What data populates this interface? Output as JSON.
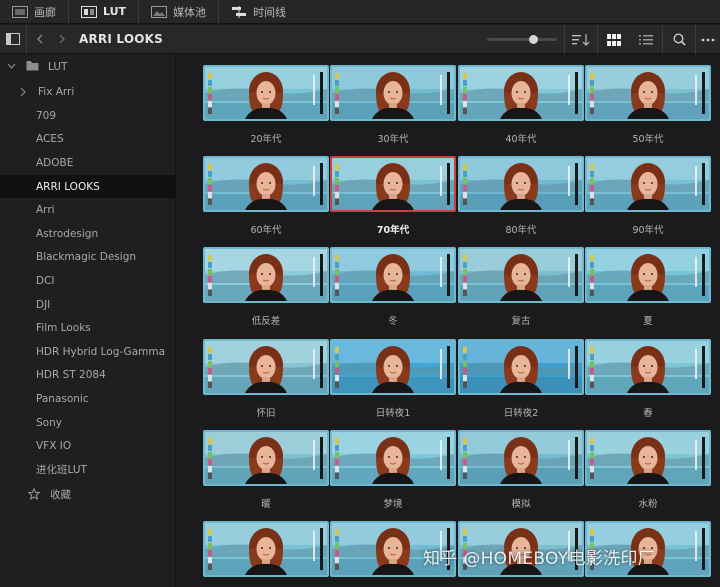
{
  "top_tabs": [
    {
      "label": "画廊",
      "icon": "gallery-icon"
    },
    {
      "label": "LUT",
      "icon": "lut-icon",
      "active": true
    },
    {
      "label": "媒体池",
      "icon": "media-pool-icon"
    },
    {
      "label": "时间线",
      "icon": "timeline-icon"
    }
  ],
  "toolbar": {
    "title": "ARRI LOOKS",
    "zoom_level": 0.45
  },
  "sidebar": {
    "root": "LUT",
    "items": [
      {
        "label": "Fix Arri",
        "expandable": true
      },
      {
        "label": "709"
      },
      {
        "label": "ACES"
      },
      {
        "label": "ADOBE"
      },
      {
        "label": "ARRI LOOKS",
        "selected": true
      },
      {
        "label": "Arri"
      },
      {
        "label": "Astrodesign"
      },
      {
        "label": "Blackmagic Design"
      },
      {
        "label": "DCI"
      },
      {
        "label": "DJI"
      },
      {
        "label": "Film Looks"
      },
      {
        "label": "HDR Hybrid Log-Gamma"
      },
      {
        "label": "HDR ST 2084"
      },
      {
        "label": "Panasonic"
      },
      {
        "label": "Sony"
      },
      {
        "label": "VFX IO"
      },
      {
        "label": "进化班LUT"
      }
    ],
    "favorites": "收藏"
  },
  "thumbnails": [
    {
      "label": "20年代",
      "tint": "#79c3d6"
    },
    {
      "label": "30年代",
      "tint": "#6fbcd2"
    },
    {
      "label": "40年代",
      "tint": "#82c7d8"
    },
    {
      "label": "50年代",
      "tint": "#7cc0d3"
    },
    {
      "label": "60年代",
      "tint": "#74bdd4"
    },
    {
      "label": "70年代",
      "tint": "#7ac2d5",
      "selected": true
    },
    {
      "label": "80年代",
      "tint": "#6eb9d1"
    },
    {
      "label": "90年代",
      "tint": "#77c0d5"
    },
    {
      "label": "低反差",
      "tint": "#8ccbd9"
    },
    {
      "label": "冬",
      "tint": "#70bcd6"
    },
    {
      "label": "复古",
      "tint": "#7cbfcf"
    },
    {
      "label": "夏",
      "tint": "#76c4d8"
    },
    {
      "label": "怀旧",
      "tint": "#86c5d3"
    },
    {
      "label": "日转夜1",
      "tint": "#3fa6d6"
    },
    {
      "label": "日转夜2",
      "tint": "#3b9fd0"
    },
    {
      "label": "春",
      "tint": "#7cc6d6"
    },
    {
      "label": "暖",
      "tint": "#7fc1cf"
    },
    {
      "label": "梦境",
      "tint": "#7ec8db"
    },
    {
      "label": "模拟",
      "tint": "#74bbd0"
    },
    {
      "label": "水粉",
      "tint": "#7ec5d6"
    },
    {
      "label": "",
      "tint": "#79c1d4"
    },
    {
      "label": "",
      "tint": "#72bdd3"
    },
    {
      "label": "",
      "tint": "#7bc0d2"
    },
    {
      "label": "",
      "tint": "#78c2d6"
    }
  ],
  "colors": {
    "selection_border": "#c9433b",
    "background": "#1b1b1d",
    "sidebar_bg": "#1f1f22"
  },
  "watermark": "知乎 @HOMEBOY电影洗印厂"
}
